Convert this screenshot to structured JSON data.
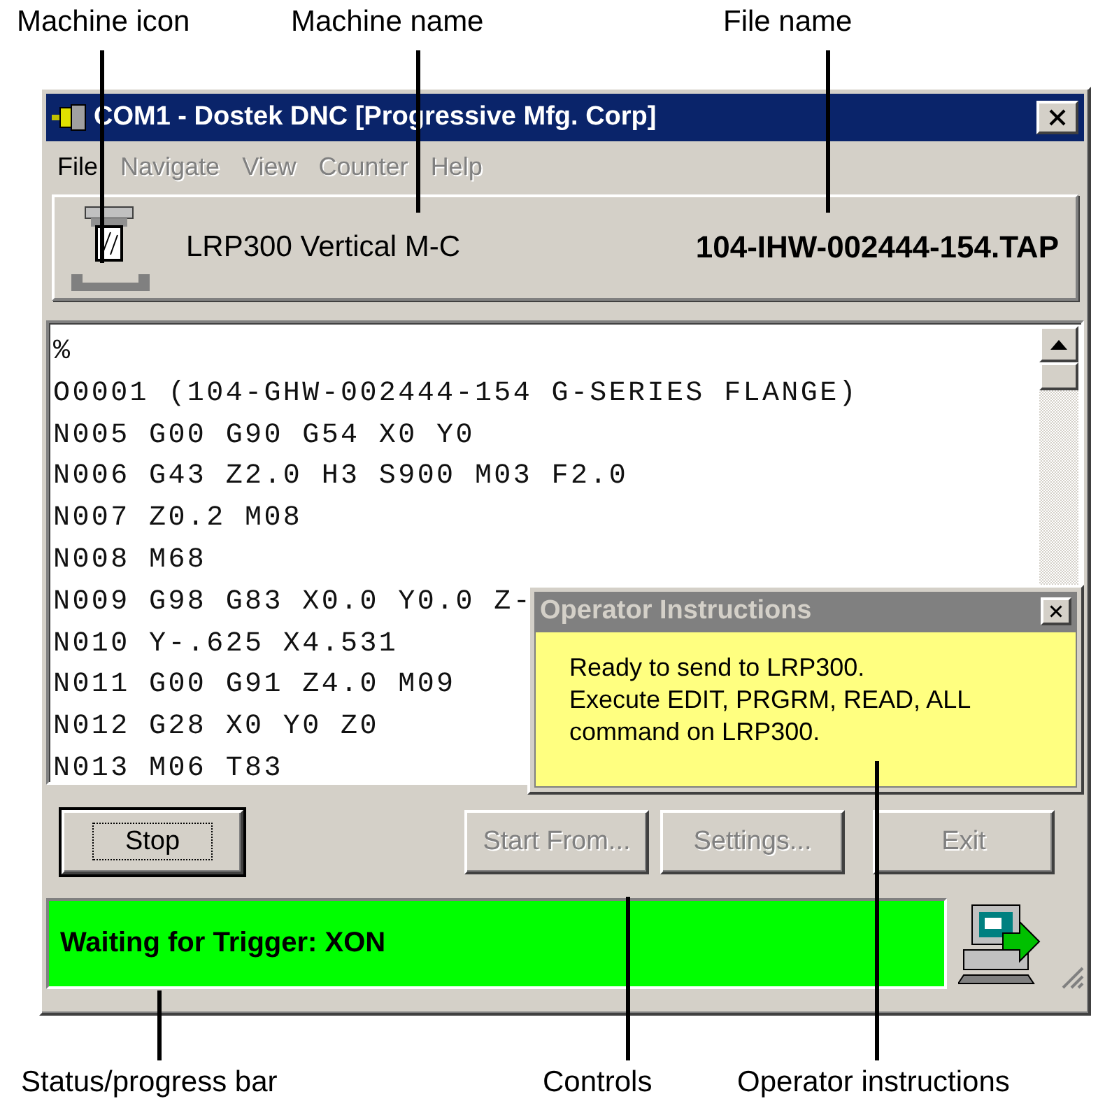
{
  "annotations_top": [
    {
      "label": "Machine icon"
    },
    {
      "label": "Machine name"
    },
    {
      "label": "File name"
    }
  ],
  "window": {
    "title": "COM1 - Dostek DNC [Progressive Mfg. Corp]"
  },
  "menu": [
    {
      "label": "File",
      "disabled": false
    },
    {
      "label": "Navigate",
      "disabled": true
    },
    {
      "label": "View",
      "disabled": true
    },
    {
      "label": "Counter",
      "disabled": true
    },
    {
      "label": "Help",
      "disabled": true
    }
  ],
  "machine": {
    "name": "LRP300 Vertical M-C",
    "file": "104-IHW-002444-154.TAP"
  },
  "program_lines": [
    "%",
    "O0001 (104-GHW-002444-154 G-SERIES FLANGE)",
    "N005 G00 G90 G54 X0 Y0",
    "N006 G43 Z2.0 H3 S900 M03 F2.0",
    "N007 Z0.2 M08",
    "N008 M68",
    "N009 G98 G83 X0.0 Y0.0 Z-",
    "N010 Y-.625 X4.531",
    "N011 G00 G91 Z4.0 M09",
    "N012 G28 X0 Y0 Z0",
    "N013 M06 T83"
  ],
  "operator_instructions": {
    "title": "Operator Instructions",
    "lines": [
      "Ready to send to LRP300.",
      "Execute EDIT, PRGRM, READ, ALL",
      "command on LRP300."
    ]
  },
  "buttons": [
    {
      "label": "Stop",
      "disabled": false
    },
    {
      "label": "Start From...",
      "disabled": true
    },
    {
      "label": "Settings...",
      "disabled": true
    },
    {
      "label": "Exit",
      "disabled": true
    }
  ],
  "status_bar": {
    "text": "Waiting for Trigger: XON"
  },
  "annotations_bottom": [
    {
      "label": "Status/progress bar"
    },
    {
      "label": "Controls"
    },
    {
      "label": "Operator instructions"
    }
  ]
}
